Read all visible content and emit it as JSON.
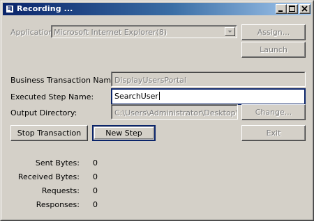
{
  "window": {
    "title": "Recording ..."
  },
  "application": {
    "label": "Application:",
    "selected": "Microsoft Internet Explorer(8)",
    "assign_label": "Assign...",
    "launch_label": "Launch"
  },
  "form": {
    "business_transaction": {
      "label": "Business Transaction Name:",
      "value": "DisplayUsersPortal"
    },
    "executed_step": {
      "label": "Executed Step Name:",
      "value": "SearchUser"
    },
    "output_directory": {
      "label": "Output Directory:",
      "value": "C:\\Users\\Administrator\\Desktop\\EEM",
      "change_label": "Change..."
    }
  },
  "actions": {
    "stop_label": "Stop Transaction",
    "new_step_label": "New Step",
    "exit_label": "Exit"
  },
  "stats": [
    {
      "label": "Sent Bytes:",
      "value": "0"
    },
    {
      "label": "Received Bytes:",
      "value": "0"
    },
    {
      "label": "Requests:",
      "value": "0"
    },
    {
      "label": "Responses:",
      "value": "0"
    }
  ]
}
